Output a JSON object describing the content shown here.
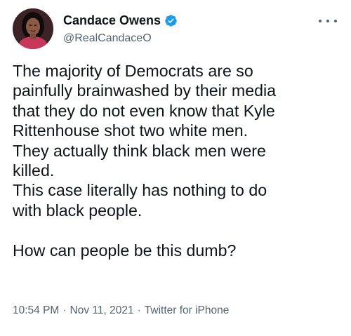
{
  "author": {
    "display_name": "Candace Owens",
    "handle": "@RealCandaceO",
    "verified": true,
    "verified_badge_icon": "verified-check-icon",
    "avatar_icon": "profile-photo"
  },
  "menu": {
    "icon": "more-options-icon"
  },
  "tweet": {
    "text": "The majority of Democrats are so\npainfully brainwashed by their media\nthat they do not even know that Kyle\nRittenhouse shot two white men.\nThey actually think black men were\nkilled.\nThis case literally has nothing to do\nwith black people.\n\nHow can people be this dumb?"
  },
  "meta": {
    "time": "10:54 PM",
    "separator": "·",
    "date": "Nov 11, 2021",
    "source": "Twitter for iPhone"
  },
  "colors": {
    "text_primary": "#0f1419",
    "text_secondary": "#536471",
    "verified_blue": "#1d9bf0",
    "background": "#ffffff"
  }
}
